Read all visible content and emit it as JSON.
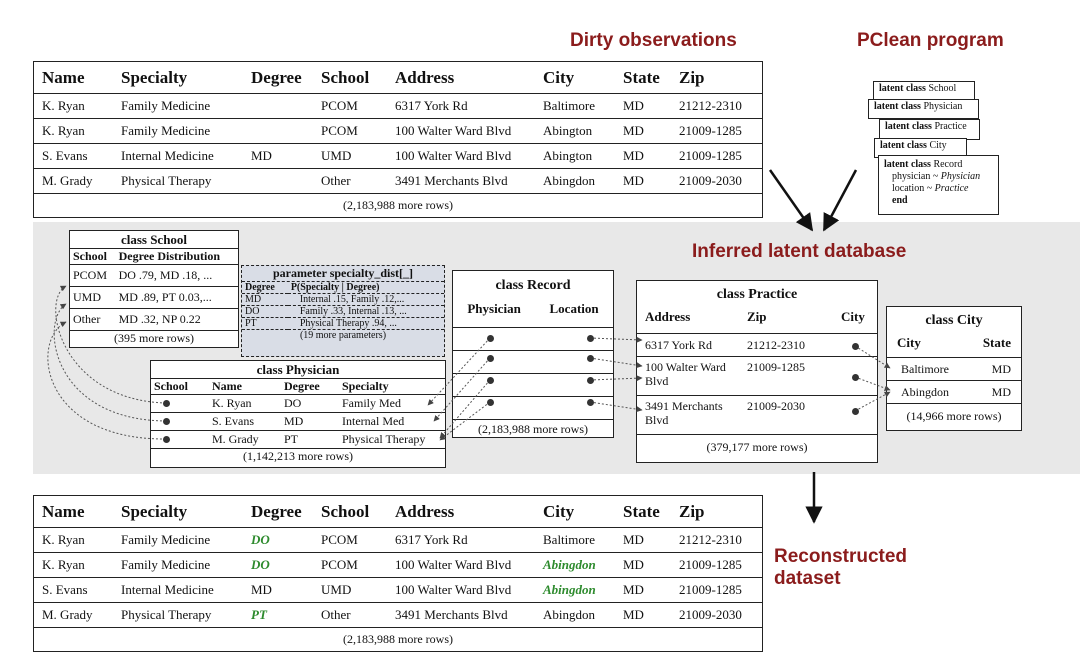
{
  "headers": {
    "dirty": "Dirty observations",
    "pclean": "PClean program",
    "inferred": "Inferred latent database",
    "reconstructed_line1": "Reconstructed",
    "reconstructed_line2": "dataset"
  },
  "dirty_table": {
    "columns": [
      "Name",
      "Specialty",
      "Degree",
      "School",
      "Address",
      "City",
      "State",
      "Zip"
    ],
    "rows": [
      [
        "K. Ryan",
        "Family Medicine",
        "",
        "PCOM",
        "6317 York Rd",
        "Baltimore",
        "MD",
        "21212-2310"
      ],
      [
        "K. Ryan",
        "Family Medicine",
        "",
        "PCOM",
        "100 Walter Ward Blvd",
        "Abington",
        "MD",
        "21009-1285"
      ],
      [
        "S. Evans",
        "Internal Medicine",
        "MD",
        "UMD",
        "100 Walter Ward Blvd",
        "Abington",
        "MD",
        "21009-1285"
      ],
      [
        "M. Grady",
        "Physical Therapy",
        "",
        "Other",
        "3491 Merchants Blvd",
        "Abingdon",
        "MD",
        "21009-2030"
      ]
    ],
    "more": "(2,183,988 more rows)"
  },
  "reconstructed_table": {
    "columns": [
      "Name",
      "Specialty",
      "Degree",
      "School",
      "Address",
      "City",
      "State",
      "Zip"
    ],
    "rows": [
      [
        "K. Ryan",
        "Family Medicine",
        "DO",
        "PCOM",
        "6317 York Rd",
        "Baltimore",
        "MD",
        "21212-2310"
      ],
      [
        "K. Ryan",
        "Family Medicine",
        "DO",
        "PCOM",
        "100 Walter Ward Blvd",
        "Abingdon",
        "MD",
        "21009-1285"
      ],
      [
        "S. Evans",
        "Internal Medicine",
        "MD",
        "UMD",
        "100 Walter Ward Blvd",
        "Abingdon",
        "MD",
        "21009-1285"
      ],
      [
        "M. Grady",
        "Physical Therapy",
        "PT",
        "Other",
        "3491 Merchants Blvd",
        "Abingdon",
        "MD",
        "21009-2030"
      ]
    ],
    "highlighted": [
      [
        0,
        2
      ],
      [
        1,
        2
      ],
      [
        1,
        5
      ],
      [
        2,
        5
      ],
      [
        3,
        2
      ]
    ],
    "more": "(2,183,988 more rows)"
  },
  "pclean_program": {
    "cards": [
      {
        "kw": "latent class",
        "name": "School"
      },
      {
        "kw": "latent class",
        "name": "Physician"
      },
      {
        "kw": "latent class",
        "name": "Practice"
      },
      {
        "kw": "latent class",
        "name": "City"
      }
    ],
    "record": {
      "kw": "latent class",
      "name": "Record",
      "line1_a": "physician ~ ",
      "line1_b": "Physician",
      "line2_a": "location ~ ",
      "line2_b": "Practice",
      "end": "end"
    }
  },
  "class_school": {
    "title": "class School",
    "columns": [
      "School",
      "Degree Distribution"
    ],
    "rows": [
      [
        "PCOM",
        "DO .79, MD .18, ..."
      ],
      [
        "UMD",
        "MD .89, PT 0.03,..."
      ],
      [
        "Other",
        "MD .32, NP 0.22"
      ]
    ],
    "more": "(395 more rows)"
  },
  "param_box": {
    "title": "parameter specialty_dist[_]",
    "columns": [
      "Degree",
      "P(Specialty | Degree)"
    ],
    "rows": [
      [
        "MD",
        "Internal .15, Family .12,..."
      ],
      [
        "DO",
        "Family .33, Internal .13, ..."
      ],
      [
        "PT",
        "Physical Therapy .94, ..."
      ]
    ],
    "more": "(19 more parameters)"
  },
  "class_physician": {
    "title": "class Physician",
    "columns": [
      "School",
      "Name",
      "Degree",
      "Specialty"
    ],
    "rows": [
      [
        "",
        "K. Ryan",
        "DO",
        "Family Med"
      ],
      [
        "",
        "S. Evans",
        "MD",
        "Internal Med"
      ],
      [
        "",
        "M. Grady",
        "PT",
        "Physical Therapy"
      ]
    ],
    "more": "(1,142,213 more rows)"
  },
  "class_record": {
    "title": "class Record",
    "columns": [
      "Physician",
      "Location"
    ],
    "more": "(2,183,988 more rows)"
  },
  "class_practice": {
    "title": "class Practice",
    "columns": [
      "Address",
      "Zip",
      "City"
    ],
    "rows": [
      [
        "6317 York Rd",
        "21212-2310"
      ],
      [
        "100 Walter Ward Blvd",
        "21009-1285"
      ],
      [
        "3491 Merchants Blvd",
        "21009-2030"
      ]
    ],
    "more": "(379,177 more rows)"
  },
  "class_city": {
    "title": "class City",
    "columns": [
      "City",
      "State"
    ],
    "rows": [
      [
        "Baltimore",
        "MD"
      ],
      [
        "Abingdon",
        "MD"
      ]
    ],
    "more": "(14,966 more rows)"
  }
}
